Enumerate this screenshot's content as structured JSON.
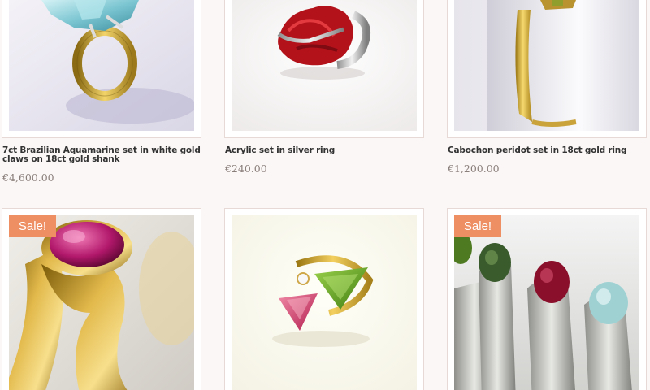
{
  "products": [
    {
      "title": "7ct Brazilian Aquamarine set in white gold claws on 18ct gold shank",
      "price": "€4,600.00",
      "image_icon": "aquamarine-ring-photo",
      "sale": false
    },
    {
      "title": "Acrylic set in silver ring",
      "price": "€240.00",
      "image_icon": "red-acrylic-silver-ring-photo",
      "sale": false
    },
    {
      "title": "Cabochon peridot set in 18ct gold ring",
      "price": "€1,200.00",
      "image_icon": "peridot-gold-ring-photo",
      "sale": false
    },
    {
      "title": "",
      "price": "",
      "image_icon": "pink-tourmaline-gold-ring-photo",
      "sale": true,
      "badge": "Sale!"
    },
    {
      "title": "",
      "price": "",
      "image_icon": "tourmaline-peridot-diamond-ring-photo",
      "sale": false
    },
    {
      "title": "",
      "price": "",
      "image_icon": "gemstone-silver-rings-photo",
      "sale": true,
      "badge": "Sale!"
    }
  ],
  "colors": {
    "sale_badge": "#ee8f63",
    "price_text": "#8a7f7b",
    "card_border": "#e6d9d6"
  }
}
